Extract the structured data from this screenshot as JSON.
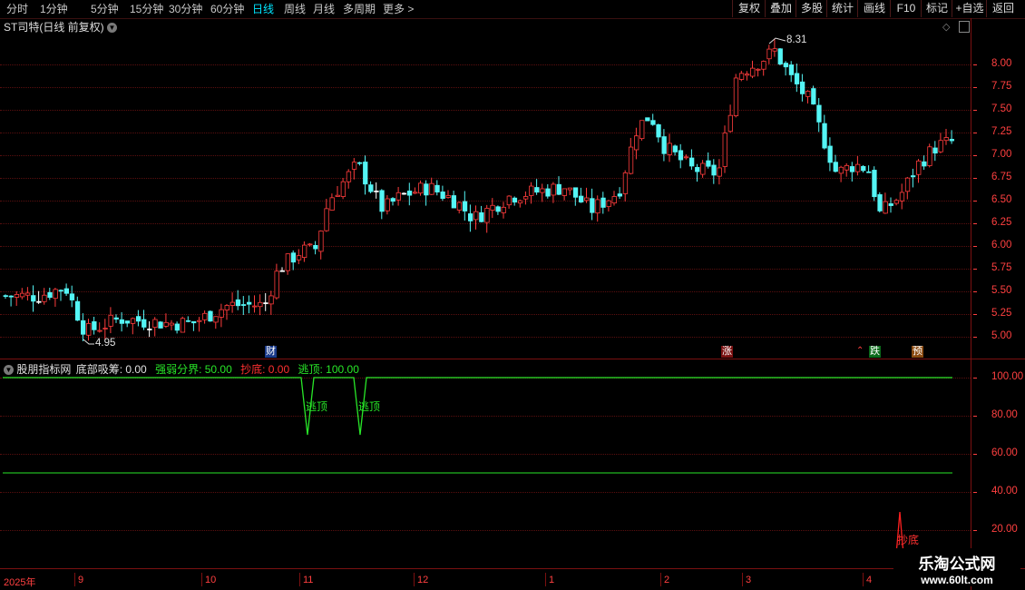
{
  "toolbar": {
    "periods": [
      "分时",
      "1分钟",
      "5分钟",
      "15分钟",
      "30分钟",
      "60分钟",
      "日线",
      "周线",
      "月线",
      "多周期",
      "更多 >"
    ],
    "active_period": "日线",
    "buttons": [
      "复权",
      "叠加",
      "多股",
      "统计",
      "画线",
      "F10",
      "标记",
      "+自选",
      "返回"
    ]
  },
  "main_chart": {
    "title": "ST司特(日线 前复权)",
    "price_axis": [
      "8.00",
      "7.75",
      "7.50",
      "7.25",
      "7.00",
      "6.75",
      "6.50",
      "6.25",
      "6.00",
      "5.75",
      "5.50",
      "5.25",
      "5.00"
    ],
    "high_label": "8.31",
    "low_label": "4.95",
    "tags": [
      "财",
      "涨",
      "跌",
      "预"
    ],
    "colors": {
      "up": "#ff3c3c",
      "down": "#54f5f5",
      "flat": "#ffffff"
    }
  },
  "indicator": {
    "name": "股朋指标网",
    "items": [
      {
        "label": "底部吸筹: 0.00",
        "color": "#e0e0e0"
      },
      {
        "label": "强弱分界: 50.00",
        "color": "#28e628"
      },
      {
        "label": "抄底: 0.00",
        "color": "#ff3030"
      },
      {
        "label": "逃顶: 100.00",
        "color": "#28e628"
      }
    ],
    "axis": [
      "100.00",
      "80.00",
      "60.00",
      "40.00",
      "20.00"
    ],
    "signals": {
      "top": "逃顶",
      "bottom": "抄底"
    }
  },
  "time_axis": [
    "2025年",
    "9",
    "10",
    "11",
    "12",
    "1",
    "2",
    "3",
    "4"
  ],
  "watermark": {
    "line1": "乐淘公式网",
    "line2": "www.60lt.com"
  }
}
